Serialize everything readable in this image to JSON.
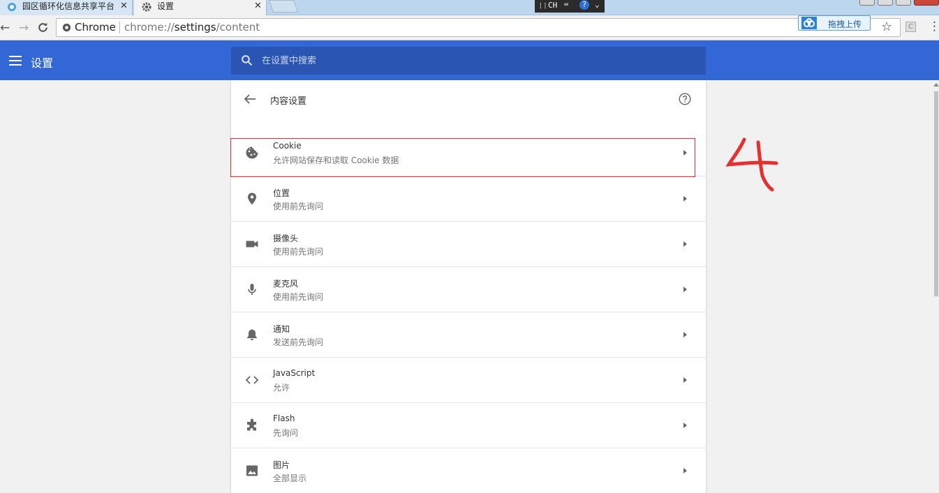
{
  "browser": {
    "tabs": [
      {
        "title": "园区循环化信息共享平台",
        "close": "✕"
      },
      {
        "title": "设置",
        "close": "✕"
      }
    ],
    "ime_label": "CH",
    "address": {
      "chip": "Chrome",
      "url_scheme": "chrome://",
      "url_host": "settings",
      "url_path": "/content"
    },
    "upload_label": "拖拽上传",
    "ext_label": "C"
  },
  "header": {
    "title": "设置",
    "search_placeholder": "在设置中搜索"
  },
  "page": {
    "title": "内容设置",
    "rows": [
      {
        "title": "Cookie",
        "subtitle": "允许网站保存和读取 Cookie 数据",
        "icon": "cookie-icon",
        "highlighted": true
      },
      {
        "title": "位置",
        "subtitle": "使用前先询问",
        "icon": "location-pin-icon"
      },
      {
        "title": "摄像头",
        "subtitle": "使用前先询问",
        "icon": "camera-icon"
      },
      {
        "title": "麦克风",
        "subtitle": "使用前先询问",
        "icon": "microphone-icon"
      },
      {
        "title": "通知",
        "subtitle": "发送前先询问",
        "icon": "bell-icon"
      },
      {
        "title": "JavaScript",
        "subtitle": "允许",
        "icon": "code-icon"
      },
      {
        "title": "Flash",
        "subtitle": "先询问",
        "icon": "puzzle-icon"
      },
      {
        "title": "图片",
        "subtitle": "全部显示",
        "icon": "image-icon"
      }
    ]
  },
  "annotation": {
    "text": "4",
    "color": "#e53030"
  },
  "colors": {
    "header_blue": "#3367d6",
    "search_bg": "#2a55b3",
    "highlight_red": "#e03131"
  }
}
